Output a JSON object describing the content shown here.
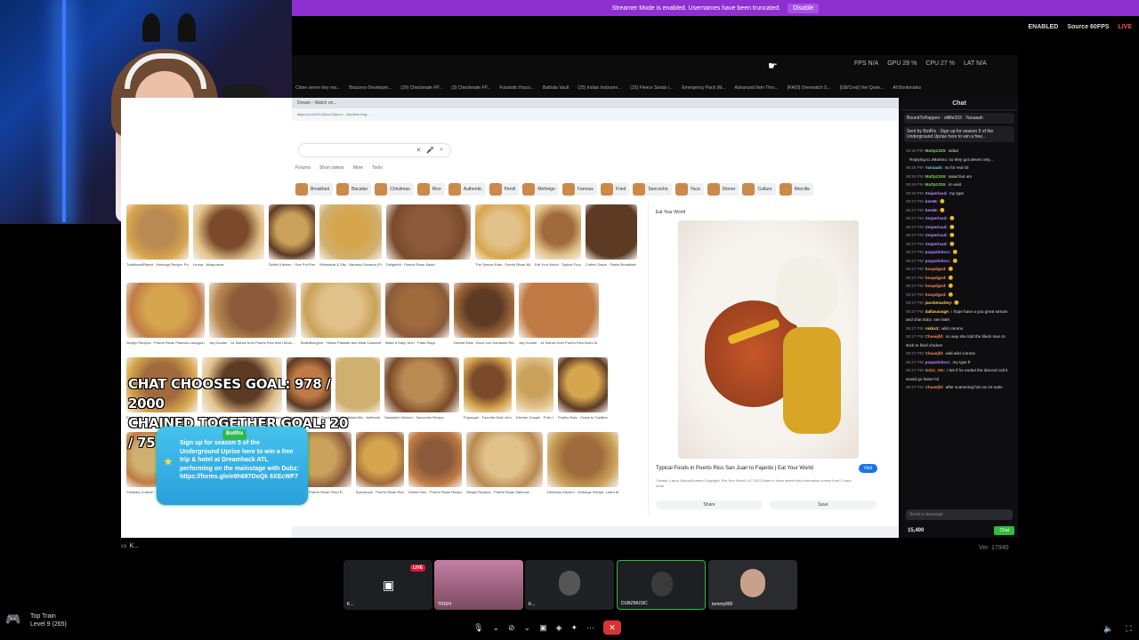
{
  "banner": {
    "text": "Streamer Mode is enabled. Usernames have been truncated.",
    "button": "Disable"
  },
  "perf": {
    "enabled": "ENABLED",
    "source": "Source 60FPS",
    "live": "LIVE"
  },
  "stats": {
    "fps": "FPS N/A",
    "gpu": "GPU 28 %",
    "cpu": "CPU 27 %",
    "lat": "LAT N/A"
  },
  "bookmarks": [
    "Clone server key rea...",
    "Brazzers-Developm...",
    "(30) Checkmate FP...",
    "(3) Checkmate FP...",
    "Futuristic Housi...",
    "Bathala Vault",
    "(25) Indian Instrume...",
    "(25) Fleece Sands (...",
    "Emergency Pack (M...",
    "Advanced Item Thro...",
    "[RAID] Overwatch S...",
    "[GB/Cred] Viel Quee...",
    "All Bookmarks"
  ],
  "browser": {
    "tab": "Dream - Watch on...",
    "url": "https://a.b/u?f=1&bn=2&bnv=...&sclient=img...",
    "navtabs": [
      "Forums",
      "Short videos",
      "More",
      "Tools"
    ],
    "chips": [
      "Breakfast",
      "Bacalao",
      "Christmas",
      "Rice",
      "Authentic",
      "Pernil",
      "Mofongo",
      "Famous",
      "Fried",
      "Sancocho",
      "Yuca",
      "Dinner",
      "Culture",
      "Morcilla"
    ],
    "tiles": [
      {
        "cap": "TraditionalPlanet · Mofongo Recipe: Puerto Rican Fried Plantains ..."
      },
      {
        "cap": "Leona · Alcapurrias"
      },
      {
        "cap": "Delish Kitchen · One Pot Puerto Rican..."
      },
      {
        "cap": "Whimsical & Sity · Bacalao Guisado (Puerto Ric..."
      },
      {
        "cap": "Delightful · Puerto Rican Salad"
      },
      {
        "cap": "The Spruce Eats · Puerto Rican Mofongo Recipe"
      },
      {
        "cap": "Eat Your World · Typical Foods in Puert..."
      },
      {
        "cap": "Coffee Graph · Pastel Breakfast Laza..."
      },
      {
        "cap": "Simply Recipes · Puerto Rican Plantain Lasagna Recipe"
      },
      {
        "cap": "Jay Dooder · 14 Dishes from Puerto Rico that I Must ..."
      },
      {
        "cap": "BoiledBurgers · Yellow Plantain and Meat Casserole ..."
      },
      {
        "cap": "Make It Daily Tech · Plato Ragu"
      },
      {
        "cap": "Dentist Eats · Arroz con Gandules Recipe"
      },
      {
        "cap": "Jay Dooder · 14 Dishes from Puerto Rico that's M..."
      },
      {
        "cap": "Elegant Guacaraca · Mofongo with Garli..."
      },
      {
        "cap": "Academy of Nutrition and Dietetics · Explore Flavorful Puerto Rican Cui..."
      },
      {
        "cap": "Pop sugar · Healthier Puerto Rican Recipes"
      },
      {
        "cap": "Mr. Breakfast Mix · Authentic Puerto Ri..."
      },
      {
        "cap": "Sandwich Kitchen · Sancocho Recipe"
      },
      {
        "cap": "Popsugar · Favorite Dish: Arroz Con Salchich..."
      },
      {
        "cap": "Kitchen Gospel · Pollo Guisado Recipe"
      },
      {
        "cap": "Pueblo Eats · Guide to Traditional..."
      },
      {
        "cap": "Cullinary Cuisine · Puerto Rican Style R..."
      },
      {
        "cap": "Latina Mom Me · Puerto Rican..."
      },
      {
        "cap": "Sun Recipe"
      },
      {
        "cap": "The Kimchery · Puerto Rican Fried R..."
      },
      {
        "cap": "Epicurious · Puerto Rican Recipes: Cuis..."
      },
      {
        "cap": "Delish Keto · Puerto Rican Recipe"
      },
      {
        "cap": "Simply Recipes · Puerto Rican Salmora..."
      },
      {
        "cap": "Delicious Kitchen · Mofongo Recipe: Learn About Mofong..."
      }
    ],
    "detail": {
      "source": "Eat Your World",
      "title": "Typical Foods in Puerto Rico San Juan to Fajardo | Eat Your World",
      "visit": "Visit",
      "credit": "Creator: Laura Ochoa/Andrew\nCopyright: Eat Your World LLC 2023\nWant to know where this information comes from? Learn more",
      "share": "Share",
      "save": "Save"
    }
  },
  "overlay": {
    "goal1": "CHAT CHOOSES GOAL: 978 / 2000",
    "goal2": "CHAINED TOGETHER GOAL: 20 / 75",
    "botrix_header": "BotRix",
    "botrix_text": "Sign up for season 5 of the Underground Uprise here to win a free trip & hotel at Dreamhack ATL performing on the mainstage with Dubz: https://forms.gle/e9h697DoQk 6XEcWF7"
  },
  "chat": {
    "header": "Chat",
    "pinned": "Sent by BotRix · Sign up for season 5 of the Underground Uprise here to win a free...",
    "top_user": "BoundToHappen · ufilife333 · Yanaaah",
    "messages": [
      {
        "t": "09:26 PM",
        "u": "Mattp2326:",
        "m": "safad"
      },
      {
        "t": "",
        "u": "",
        "m": "Replying to JMarimo: so they got desert only..."
      },
      {
        "t": "09:26 PM",
        "u": "Yanaaah:",
        "m": "no for real lol"
      },
      {
        "t": "09:26 PM",
        "u": "Mattp2326:",
        "m": "salad but um"
      },
      {
        "t": "09:26 PM",
        "u": "Mattp2326:",
        "m": "im wait"
      },
      {
        "t": "09:26 PM",
        "u": "Sniperload:",
        "m": "my type"
      },
      {
        "t": "09:27 PM",
        "u": "bee56:",
        "m": "😊"
      },
      {
        "t": "09:27 PM",
        "u": "bee56:",
        "m": "😊"
      },
      {
        "t": "09:27 PM",
        "u": "Sniperload:",
        "m": "😊"
      },
      {
        "t": "09:27 PM",
        "u": "Sniperload:",
        "m": "😊"
      },
      {
        "t": "09:27 PM",
        "u": "Sniperload:",
        "m": "😊"
      },
      {
        "t": "09:27 PM",
        "u": "Sniperload:",
        "m": "😊"
      },
      {
        "t": "09:27 PM",
        "u": "poppahdocc:",
        "m": "😊"
      },
      {
        "t": "09:27 PM",
        "u": "poppahdocc:",
        "m": "😊"
      },
      {
        "t": "09:27 PM",
        "u": "hoopdgod:",
        "m": "😊"
      },
      {
        "t": "09:27 PM",
        "u": "hoopdgod:",
        "m": "😊"
      },
      {
        "t": "09:27 PM",
        "u": "hoopdgod:",
        "m": "😊"
      },
      {
        "t": "09:27 PM",
        "u": "hoopdgod:",
        "m": "😊"
      },
      {
        "t": "09:27 PM",
        "u": "jacobmuckey:",
        "m": "😊"
      },
      {
        "t": "09:27 PM",
        "u": "dallasavage:",
        "m": "i hope have a you great stream and chat dubz. see later."
      },
      {
        "t": "09:27 PM",
        "u": "rokkx3:",
        "m": "wild comms"
      },
      {
        "t": "09:27 PM",
        "u": "Chasejfd:",
        "m": "no way she told the black man to stick to fried chicken"
      },
      {
        "t": "09:27 PM",
        "u": "Chasejfd:",
        "m": "wild wild comms"
      },
      {
        "t": "09:27 PM",
        "u": "poppahdocc:",
        "m": "my type fr"
      },
      {
        "t": "09:27 PM",
        "u": "Grizz_OG:",
        "m": "i bet if he ended the discord call it would go faster lol"
      },
      {
        "t": "09:27 PM",
        "u": "Chasejfd:",
        "m": "after scamming him on 10 subs"
      }
    ],
    "input_placeholder": "Send a message",
    "points": "15,400",
    "send": "Chat"
  },
  "discord": {
    "stream_tag": "K...",
    "version": "Ver. 17940",
    "participants": [
      {
        "name": "K...",
        "live": "LIVE"
      },
      {
        "name": "TRISH"
      },
      {
        "name": "K..."
      },
      {
        "name": "DUBZMUSIC"
      },
      {
        "name": "tommy900"
      }
    ],
    "profile": {
      "name": "Top Train",
      "level": "Level 9 (265)"
    }
  },
  "colors": {
    "banner": "#8e2fd0",
    "accent_green": "#2fbd3a",
    "live_red": "#e3163c",
    "link_blue": "#1a73e8"
  }
}
